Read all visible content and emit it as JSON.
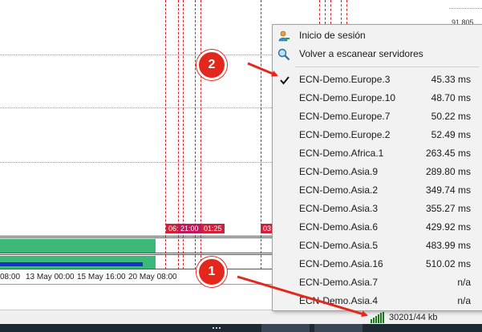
{
  "chart": {
    "price_label": "91.805",
    "time_labels": [
      "08:00",
      "13 May 00:00",
      "15 May 16:00",
      "20 May 08:00"
    ],
    "session_tags": [
      "06:",
      "21:00",
      "01:25",
      "03"
    ]
  },
  "menu": {
    "login_label": "Inicio de sesión",
    "rescan_label": "Volver a escanear servidores",
    "servers": [
      {
        "name": "ECN-Demo.Europe.3",
        "ping": "45.33 ms",
        "checked": true
      },
      {
        "name": "ECN-Demo.Europe.10",
        "ping": "48.70 ms"
      },
      {
        "name": "ECN-Demo.Europe.7",
        "ping": "50.22 ms"
      },
      {
        "name": "ECN-Demo.Europe.2",
        "ping": "52.49 ms"
      },
      {
        "name": "ECN-Demo.Africa.1",
        "ping": "263.45 ms"
      },
      {
        "name": "ECN-Demo.Asia.9",
        "ping": "289.80 ms"
      },
      {
        "name": "ECN-Demo.Asia.2",
        "ping": "349.74 ms"
      },
      {
        "name": "ECN-Demo.Asia.3",
        "ping": "355.27 ms"
      },
      {
        "name": "ECN-Demo.Asia.6",
        "ping": "429.92 ms"
      },
      {
        "name": "ECN-Demo.Asia.5",
        "ping": "483.99 ms"
      },
      {
        "name": "ECN-Demo.Asia.16",
        "ping": "510.02 ms"
      },
      {
        "name": "ECN-Demo.Asia.7",
        "ping": "n/a"
      },
      {
        "name": "ECN-Demo.Asia.4",
        "ping": "n/a"
      }
    ]
  },
  "status": {
    "traffic": "30201/44 kb",
    "connection_icon": "connection-bars-icon"
  },
  "annotations": {
    "badge_1": "1",
    "badge_2": "2"
  },
  "colors": {
    "annotation_red": "#e4271d",
    "session_line": "#e02020",
    "indicator_green": "#3cb878",
    "indicator_blue": "#1a2fd0",
    "tag_red": "#d0213a",
    "tag_magenta": "#c2185b"
  }
}
